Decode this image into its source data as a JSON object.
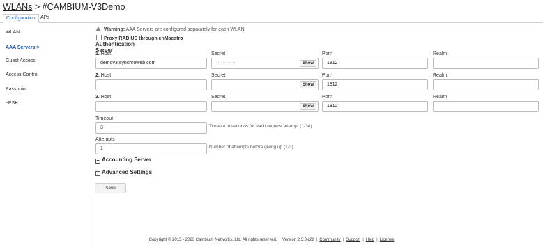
{
  "header": {
    "breadcrumb_link": "WLANs",
    "breadcrumb_sep": ">",
    "title": "#CAMBIUM-V3Demo"
  },
  "tabs": [
    {
      "label": "Configuration",
      "active": true
    },
    {
      "label": "APs",
      "active": false
    }
  ],
  "sidebar": {
    "items": [
      {
        "label": "WLAN"
      },
      {
        "label": "AAA Servers >",
        "active": true
      },
      {
        "label": "Guest Access"
      },
      {
        "label": "Access Control"
      },
      {
        "label": "Passpoint"
      },
      {
        "label": "ePSK"
      }
    ]
  },
  "warning": {
    "prefix": "Warning:",
    "text": "AAA Servers are configured separately for each WLAN."
  },
  "proxy_checkbox": {
    "label": "Proxy RADIUS through cnMaestro",
    "checked": false
  },
  "auth_server": {
    "section_title": "Authentication Server",
    "col_host": "Host",
    "col_secret": "Secret",
    "col_port": "Port*",
    "col_realm": "Realm",
    "show_label": "Show",
    "rows": [
      {
        "num": "1.",
        "host": "demov3.synchroweb.com",
        "secret": "············",
        "port": "1812",
        "realm": ""
      },
      {
        "num": "2.",
        "host": "",
        "secret": "",
        "port": "1812",
        "realm": ""
      },
      {
        "num": "3.",
        "host": "",
        "secret": "",
        "port": "1812",
        "realm": ""
      }
    ]
  },
  "timeout": {
    "label": "Timeout",
    "value": "3",
    "hint": "Timeout in seconds for each request attempt (1-30)"
  },
  "attempts": {
    "label": "Attempts",
    "value": "1",
    "hint": "Number of attempts before giving up (1-3)"
  },
  "accounting": {
    "label": "Accounting Server"
  },
  "advanced": {
    "label": "Advanced Settings"
  },
  "save_label": "Save",
  "footer": {
    "copyright": "Copyright © 2015 - 2023 Cambium Networks, Ltd. All rights reserved.",
    "version": "Version 2.3.0-r28",
    "links": [
      "Community",
      "Support",
      "Help",
      "License"
    ]
  }
}
